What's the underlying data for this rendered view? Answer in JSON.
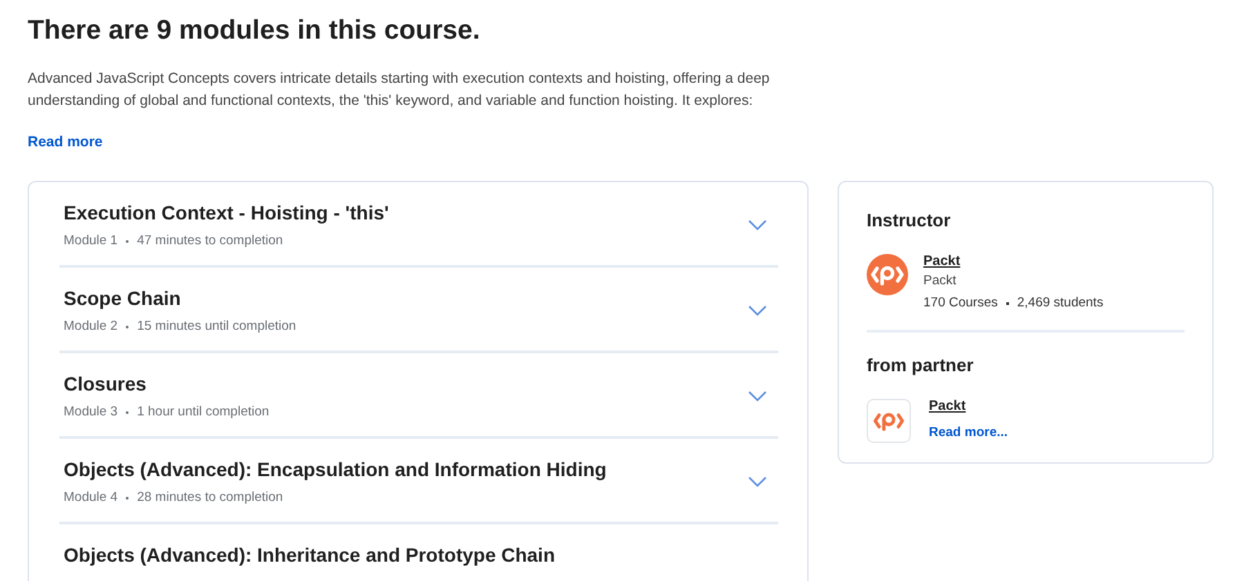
{
  "heading": "There are 9 modules in this course.",
  "description": "Advanced JavaScript Concepts covers intricate details starting with execution contexts and hoisting, offering a deep understanding of global and functional contexts, the 'this' keyword, and variable and function hoisting. It explores:",
  "read_more": "Read more",
  "modules": [
    {
      "title": "Execution Context - Hoisting - 'this'",
      "module": "Module 1",
      "duration": "47 minutes to completion",
      "expanded": false
    },
    {
      "title": "Scope Chain",
      "module": "Module 2",
      "duration": "15 minutes until completion",
      "expanded": false
    },
    {
      "title": "Closures",
      "module": "Module 3",
      "duration": "1 hour until completion",
      "expanded": false
    },
    {
      "title": "Objects (Advanced): Encapsulation and Information Hiding",
      "module": "Module 4",
      "duration": "28 minutes to completion",
      "expanded": false
    },
    {
      "title": "Objects (Advanced): Inheritance and Prototype Chain"
    }
  ],
  "instructor": {
    "heading": "Instructor",
    "name": "Packt",
    "organization": "Packt",
    "courses": "170 Courses",
    "students": "2,469 students"
  },
  "partner": {
    "heading": "from partner",
    "name": "Packt",
    "read_more": "Read more..."
  }
}
